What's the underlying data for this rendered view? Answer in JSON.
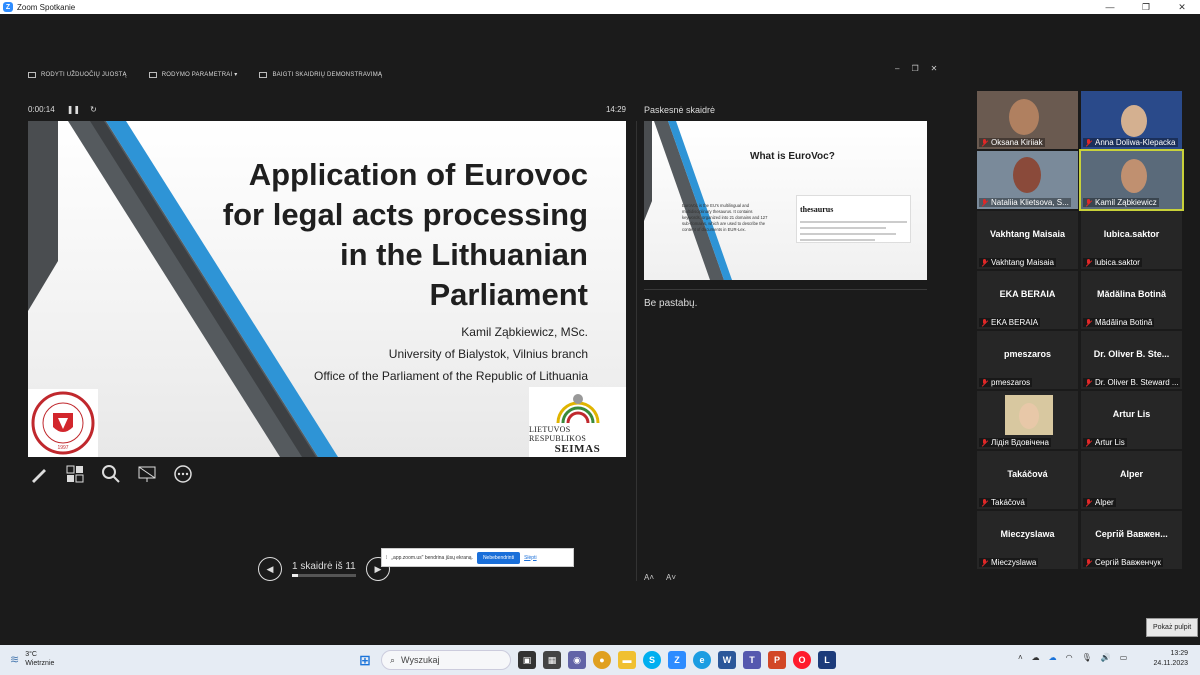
{
  "window": {
    "title": "Zoom Spotkanie"
  },
  "presenter_toolbar": {
    "show_taskbar": "RODYTI UŽDUOČIŲ JUOSTĄ",
    "display_settings": "RODYMO PARAMETRAI ▾",
    "end_slideshow": "BAIGTI SKAIDRIŲ DEMONSTRAVIMĄ"
  },
  "presenter": {
    "elapsed": "0:00:14",
    "clock": "14:29",
    "next_slide_label": "Paskesnė skaidrė",
    "notes": "Be pastabų.",
    "slide_counter": "1 skaidrė iš 11"
  },
  "slide": {
    "title_lines": [
      "Application of Eurovoc",
      "for legal acts processing",
      "in the Lithuanian",
      "Parliament"
    ],
    "author_lines": [
      "Kamil Ząbkiewicz, MSc.",
      "University of Bialystok, Vilnius branch",
      "Office of the Parliament of the Republic of Lithuania"
    ],
    "logo_right_line1": "LIETUVOS RESPUBLIKOS",
    "logo_right_line2": "SEIMAS",
    "logo_left_year": "1997"
  },
  "next_slide": {
    "title": "What is EuroVoc?",
    "bullet": "EuroVoc is the EU's multilingual and multidisciplinary thesaurus. It contains keywords, organized into 21 domains and 127 sub-domains, which are used to describe the content of documents in EUR-Lex.",
    "thesaurus_word": "thesaurus"
  },
  "share_bar": {
    "message": "„app.zoom.us\" bendrina jūsų ekraną.",
    "stop": "Nebebendrinti",
    "hide": "Slėpti"
  },
  "participants": [
    {
      "label": "Oksana Kiriiak",
      "video": true
    },
    {
      "label": "Anna Doliwa-Klepacka",
      "video": true
    },
    {
      "label": "Nataliia Klietsova, S...",
      "video": true
    },
    {
      "label": "Kamil Ząbkiewicz",
      "video": true,
      "active": true
    },
    {
      "name": "Vakhtang Maisaia",
      "label": "Vakhtang Maisaia"
    },
    {
      "name": "lubica.saktor",
      "label": "lubica.saktor"
    },
    {
      "name": "EKA BERAIA",
      "label": "EKA BERAIA"
    },
    {
      "name": "Mădălina Botină",
      "label": "Mădălina Botină"
    },
    {
      "name": "pmeszaros",
      "label": "pmeszaros"
    },
    {
      "name": "Dr. Oliver B. Ste...",
      "label": "Dr. Oliver B. Steward ..."
    },
    {
      "label": "Лідія Вдовічена",
      "video": true,
      "avatar": true
    },
    {
      "name": "Artur Lis",
      "label": "Artur Lis"
    },
    {
      "name": "Takáčová",
      "label": "Takáčová"
    },
    {
      "name": "Alper",
      "label": "Alper"
    },
    {
      "name": "Mieczyslawa",
      "label": "Mieczyslawa"
    },
    {
      "name": "Сергій Вавжен...",
      "label": "Сергій Вавженчук"
    }
  ],
  "show_desktop": "Pokaż pulpit",
  "taskbar": {
    "temperature": "3°C",
    "weather": "Wietrznie",
    "search_placeholder": "Wyszukaj",
    "time": "13:29",
    "date": "24.11.2023"
  }
}
